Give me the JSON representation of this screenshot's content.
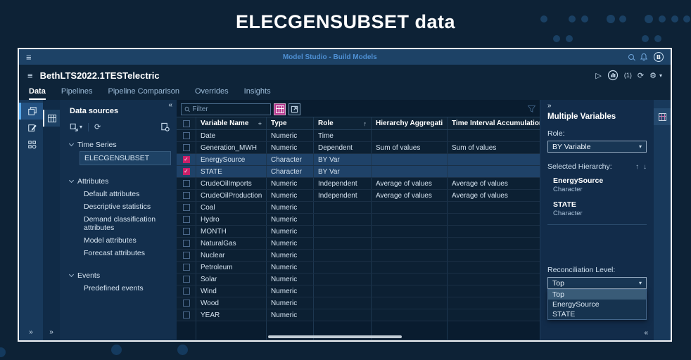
{
  "banner": {
    "title": "ELECGENSUBSET data"
  },
  "app_bar": {
    "title": "Model Studio - Build Models",
    "avatar_initial": "B"
  },
  "project_bar": {
    "title": "BethLTS2022.1TESTelectric",
    "run_count": "(1)"
  },
  "tabs": [
    {
      "label": "Data",
      "active": true
    },
    {
      "label": "Pipelines"
    },
    {
      "label": "Pipeline Comparison"
    },
    {
      "label": "Overrides"
    },
    {
      "label": "Insights"
    }
  ],
  "data_sources": {
    "title": "Data sources",
    "time_series_label": "Time Series",
    "time_series_item": "ELECGENSUBSET",
    "attributes_label": "Attributes",
    "attributes_items": [
      "Default attributes",
      "Descriptive statistics",
      "Demand classification attributes",
      "Model attributes",
      "Forecast attributes"
    ],
    "events_label": "Events",
    "events_items": [
      "Predefined events"
    ]
  },
  "table": {
    "filter_placeholder": "Filter",
    "columns": [
      "Variable Name",
      "Type",
      "Role",
      "Hierarchy Aggregation",
      "Time Interval Accumulation"
    ],
    "rows": [
      {
        "name": "Date",
        "type": "Numeric",
        "role": "Time",
        "hier": "",
        "time": ""
      },
      {
        "name": "Generation_MWH",
        "type": "Numeric",
        "role": "Dependent",
        "hier": "Sum of values",
        "time": "Sum of values"
      },
      {
        "name": "EnergySource",
        "type": "Character",
        "role": "BY Var",
        "hier": "",
        "time": "",
        "checked": true,
        "selected": true
      },
      {
        "name": "STATE",
        "type": "Character",
        "role": "BY Var",
        "hier": "",
        "time": "",
        "checked": true,
        "selected": true
      },
      {
        "name": "CrudeOilImports",
        "type": "Numeric",
        "role": "Independent",
        "hier": "Average of values",
        "time": "Average of values"
      },
      {
        "name": "CrudeOilProduction",
        "type": "Numeric",
        "role": "Independent",
        "hier": "Average of values",
        "time": "Average of values"
      },
      {
        "name": "Coal",
        "type": "Numeric",
        "role": "",
        "hier": "",
        "time": ""
      },
      {
        "name": "Hydro",
        "type": "Numeric",
        "role": "",
        "hier": "",
        "time": ""
      },
      {
        "name": "MONTH",
        "type": "Numeric",
        "role": "",
        "hier": "",
        "time": ""
      },
      {
        "name": "NaturalGas",
        "type": "Numeric",
        "role": "",
        "hier": "",
        "time": ""
      },
      {
        "name": "Nuclear",
        "type": "Numeric",
        "role": "",
        "hier": "",
        "time": ""
      },
      {
        "name": "Petroleum",
        "type": "Numeric",
        "role": "",
        "hier": "",
        "time": ""
      },
      {
        "name": "Solar",
        "type": "Numeric",
        "role": "",
        "hier": "",
        "time": ""
      },
      {
        "name": "Wind",
        "type": "Numeric",
        "role": "",
        "hier": "",
        "time": ""
      },
      {
        "name": "Wood",
        "type": "Numeric",
        "role": "",
        "hier": "",
        "time": ""
      },
      {
        "name": "YEAR",
        "type": "Numeric",
        "role": "",
        "hier": "",
        "time": ""
      }
    ]
  },
  "right_panel": {
    "title": "Multiple Variables",
    "role_label": "Role:",
    "role_value": "BY Variable",
    "hierarchy_label": "Selected Hierarchy:",
    "hierarchy_items": [
      {
        "name": "EnergySource",
        "type": "Character"
      },
      {
        "name": "STATE",
        "type": "Character"
      }
    ],
    "reconciliation_label": "Reconciliation Level:",
    "reconciliation_value": "Top",
    "reconciliation_options": [
      {
        "label": "Top",
        "selected": true
      },
      {
        "label": "EnergySource"
      },
      {
        "label": "STATE"
      }
    ]
  },
  "icons": {
    "hamburger": "≡",
    "list": "≡",
    "play": "▷",
    "refresh": "⟳",
    "gear": "⚙",
    "caret_down": "▾",
    "collapse_left": "«",
    "expand_right": "»",
    "arrow_up": "↑",
    "arrow_down": "↓",
    "check": "✓",
    "sort_plus": "+",
    "kebab": "⋮"
  },
  "colors": {
    "accent_magenta": "#cb2069",
    "link_blue": "#4e90d4",
    "selection_blue": "#1f4268"
  }
}
